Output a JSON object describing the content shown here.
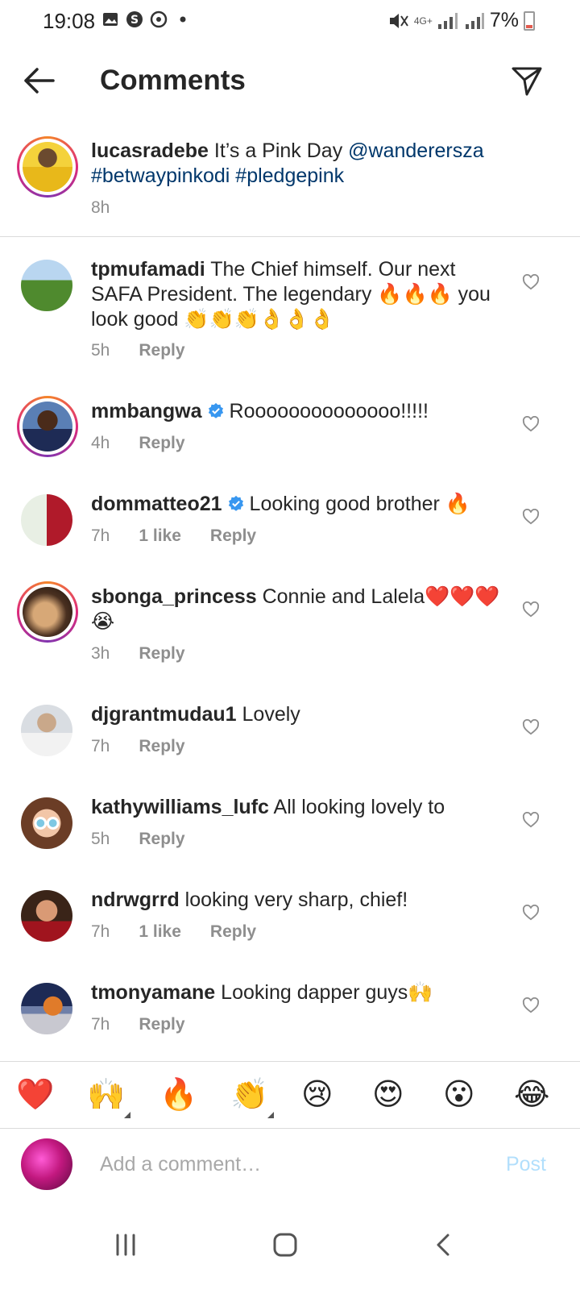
{
  "status_bar": {
    "time": "19:08",
    "network": "4G+",
    "battery": "7%"
  },
  "header": {
    "title": "Comments"
  },
  "caption": {
    "username": "lucasradebe",
    "text": "It’s a Pink Day",
    "mention": "@wanderersza",
    "hashtags": "#betwaypinkodi #pledgepink",
    "time": "8h"
  },
  "comments": [
    {
      "username": "tpmufamadi",
      "text": "The Chief himself. Our next SAFA President. The legendary 🔥🔥🔥 you look good 👏👏👏👌👌👌",
      "time": "5h",
      "likes": "",
      "reply": "Reply",
      "verified": false
    },
    {
      "username": "mmbangwa",
      "text": "Roooooooooooooo!!!!!",
      "time": "4h",
      "likes": "",
      "reply": "Reply",
      "verified": true
    },
    {
      "username": "dommatteo21",
      "text": "Looking good brother 🔥",
      "time": "7h",
      "likes": "1 like",
      "reply": "Reply",
      "verified": true
    },
    {
      "username": "sbonga_princess",
      "text": "Connie and Lalela❤️❤️❤️😭",
      "time": "3h",
      "likes": "",
      "reply": "Reply",
      "verified": false
    },
    {
      "username": "djgrantmudau1",
      "text": "Lovely",
      "time": "7h",
      "likes": "",
      "reply": "Reply",
      "verified": false
    },
    {
      "username": "kathywilliams_lufc",
      "text": "All looking lovely to",
      "time": "5h",
      "likes": "",
      "reply": "Reply",
      "verified": false
    },
    {
      "username": "ndrwgrrd",
      "text": "looking very sharp, chief!",
      "time": "7h",
      "likes": "1 like",
      "reply": "Reply",
      "verified": false
    },
    {
      "username": "tmonyamane",
      "text": "Looking dapper guys🙌",
      "time": "7h",
      "likes": "",
      "reply": "Reply",
      "verified": false
    }
  ],
  "emoji_bar": [
    "❤️",
    "🙌",
    "🔥",
    "👏",
    "😢",
    "😍",
    "😮",
    "😂"
  ],
  "composer": {
    "placeholder": "Add a comment…",
    "post_label": "Post"
  },
  "colors": {
    "link": "#00376b",
    "verified": "#3897f0",
    "post_disabled": "#b2dffc",
    "meta": "#8e8e8e"
  }
}
